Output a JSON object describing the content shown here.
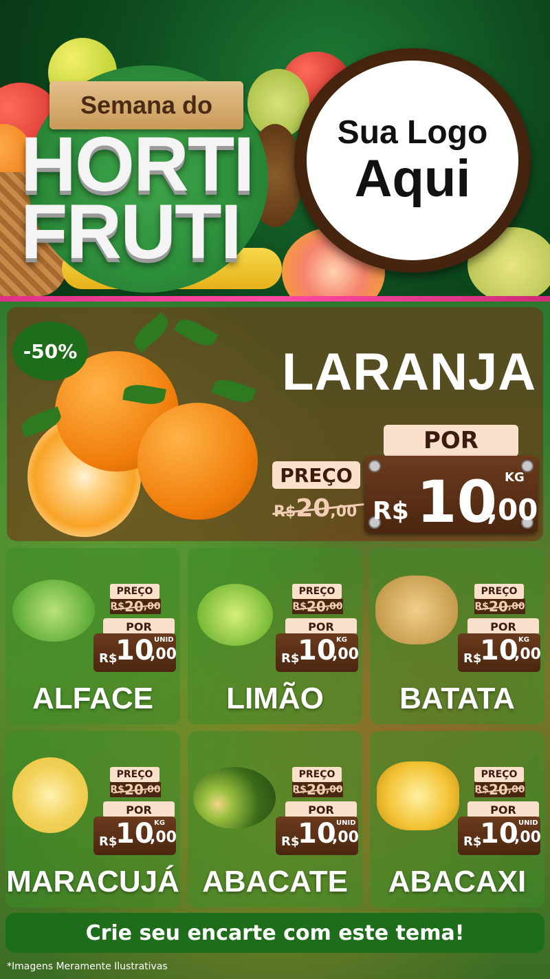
{
  "header": {
    "subtitle": "Semana do",
    "title_line1": "HORTI",
    "title_line2": "FRUTI",
    "logo_line1": "Sua Logo",
    "logo_line2": "Aqui"
  },
  "hero": {
    "badge": "-50%",
    "name": "LARANJA",
    "preco_label": "PREÇO",
    "old_currency": "R$",
    "old_int": "20",
    "old_cents": ",00",
    "por_label": "POR",
    "currency": "R$",
    "price_int": "10",
    "price_cents": ",00",
    "unit": "KG"
  },
  "products": [
    {
      "name": "ALFACE",
      "preco_label": "PREÇO",
      "old_currency": "R$",
      "old_int": "20",
      "old_cents": ",00",
      "por_label": "POR",
      "currency": "R$",
      "price_int": "10",
      "price_cents": ",00",
      "unit": "UNID",
      "icon": "lettuce-icon"
    },
    {
      "name": "LIMÃO",
      "preco_label": "PREÇO",
      "old_currency": "R$",
      "old_int": "20",
      "old_cents": ",00",
      "por_label": "POR",
      "currency": "R$",
      "price_int": "10",
      "price_cents": ",00",
      "unit": "KG",
      "icon": "lime-icon"
    },
    {
      "name": "BATATA",
      "preco_label": "PREÇO",
      "old_currency": "R$",
      "old_int": "20",
      "old_cents": ",00",
      "por_label": "POR",
      "currency": "R$",
      "price_int": "10",
      "price_cents": ",00",
      "unit": "KG",
      "icon": "potato-icon"
    },
    {
      "name": "MARACUJÁ",
      "preco_label": "PREÇO",
      "old_currency": "R$",
      "old_int": "20",
      "old_cents": ",00",
      "por_label": "POR",
      "currency": "R$",
      "price_int": "10",
      "price_cents": ",00",
      "unit": "KG",
      "icon": "passionfruit-icon"
    },
    {
      "name": "ABACATE",
      "preco_label": "PREÇO",
      "old_currency": "R$",
      "old_int": "20",
      "old_cents": ",00",
      "por_label": "POR",
      "currency": "R$",
      "price_int": "10",
      "price_cents": ",00",
      "unit": "UNID",
      "icon": "avocado-icon"
    },
    {
      "name": "ABACAXI",
      "preco_label": "PREÇO",
      "old_currency": "R$",
      "old_int": "20",
      "old_cents": ",00",
      "por_label": "POR",
      "currency": "R$",
      "price_int": "10",
      "price_cents": ",00",
      "unit": "UNID",
      "icon": "pineapple-icon"
    }
  ],
  "cta": "Crie seu encarte com este tema!",
  "footnote": "*Imagens Meramente Ilustrativas",
  "colors": {
    "brand_green": "#1e6d1a",
    "wood": "#4b2610",
    "label_bg": "#fbe0cc",
    "accent_pink": "#e0308a"
  }
}
